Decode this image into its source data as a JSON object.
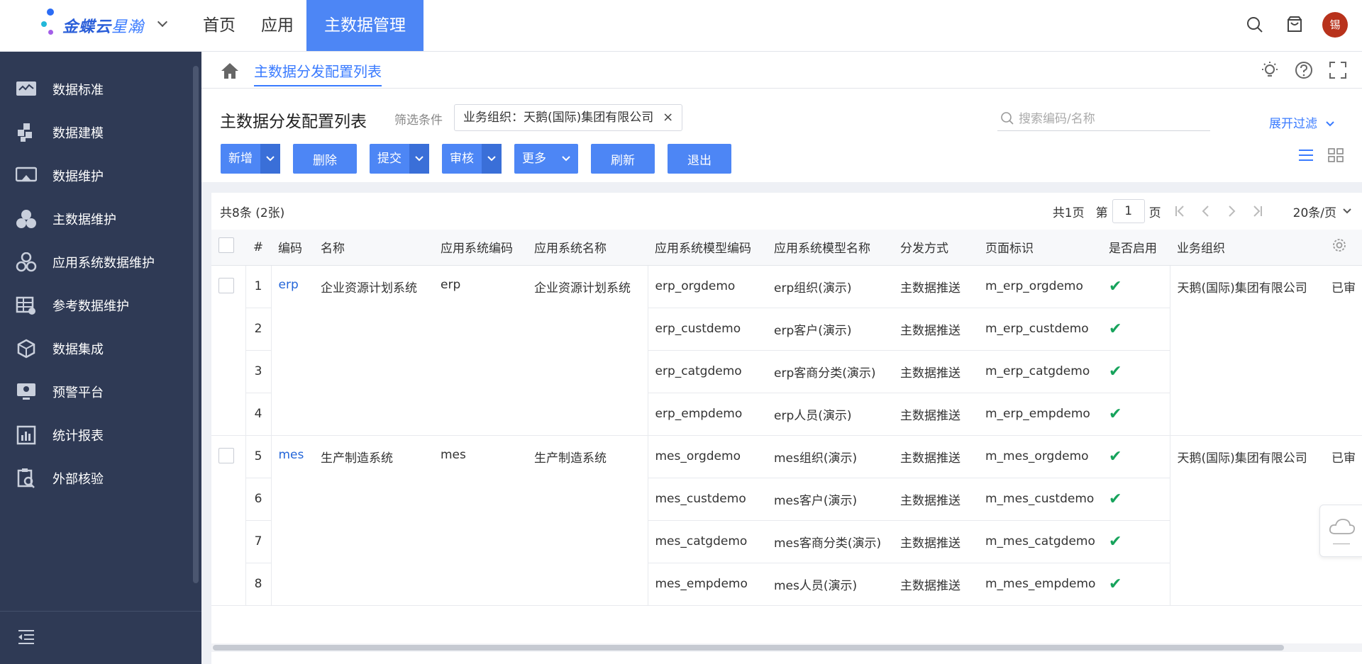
{
  "brand": {
    "name_bold": "金蝶云",
    "name_light": "星瀚"
  },
  "top_nav": [
    {
      "label": "首页",
      "active": false
    },
    {
      "label": "应用",
      "active": false
    },
    {
      "label": "主数据管理",
      "active": true
    }
  ],
  "user": {
    "avatar_text": "锡"
  },
  "sidebar": {
    "items": [
      {
        "label": "数据标准",
        "icon": "monitor-chart-icon"
      },
      {
        "label": "数据建模",
        "icon": "blocks-icon"
      },
      {
        "label": "数据维护",
        "icon": "screen-icon"
      },
      {
        "label": "主数据维护",
        "icon": "circles-icon"
      },
      {
        "label": "应用系统数据维护",
        "icon": "settings-cluster-icon"
      },
      {
        "label": "参考数据维护",
        "icon": "table-gear-icon"
      },
      {
        "label": "数据集成",
        "icon": "cube-icon"
      },
      {
        "label": "预警平台",
        "icon": "alert-screen-icon"
      },
      {
        "label": "统计报表",
        "icon": "bar-report-icon"
      },
      {
        "label": "外部核验",
        "icon": "clipboard-search-icon"
      }
    ]
  },
  "breadcrumb": {
    "current": "主数据分发配置列表"
  },
  "header": {
    "title": "主数据分发配置列表",
    "filter_label": "筛选条件",
    "filter_chip": "业务组织：天鹅(国际)集团有限公司",
    "filter_chip_close": "×",
    "search_placeholder": "搜索编码/名称",
    "expand_filter": "展开过滤"
  },
  "toolbar": {
    "add": "新增",
    "delete": "删除",
    "submit": "提交",
    "audit": "审核",
    "more": "更多",
    "refresh": "刷新",
    "exit": "退出"
  },
  "table": {
    "stats": "共8条 (2张)",
    "pager": {
      "total_pages": "共1页",
      "page_prefix": "第",
      "page_value": "1",
      "page_suffix": "页",
      "page_size": "20条/页"
    },
    "columns": [
      "#",
      "编码",
      "名称",
      "应用系统编码",
      "应用系统名称",
      "应用系统模型编码",
      "应用系统模型名称",
      "分发方式",
      "页面标识",
      "是否启用",
      "业务组织"
    ],
    "groups": [
      {
        "code": "erp",
        "name": "企业资源计划系统",
        "app_code": "erp",
        "app_name": "企业资源计划系统",
        "org": "天鹅(国际)集团有限公司",
        "status_partial": "已审",
        "rows": [
          {
            "seq": "1",
            "model_code": "erp_orgdemo",
            "model_name": "erp组织(演示)",
            "method": "主数据推送",
            "page_id": "m_erp_orgdemo",
            "enabled": "✔"
          },
          {
            "seq": "2",
            "model_code": "erp_custdemo",
            "model_name": "erp客户(演示)",
            "method": "主数据推送",
            "page_id": "m_erp_custdemo",
            "enabled": "✔"
          },
          {
            "seq": "3",
            "model_code": "erp_catgdemo",
            "model_name": "erp客商分类(演示)",
            "method": "主数据推送",
            "page_id": "m_erp_catgdemo",
            "enabled": "✔"
          },
          {
            "seq": "4",
            "model_code": "erp_empdemo",
            "model_name": "erp人员(演示)",
            "method": "主数据推送",
            "page_id": "m_erp_empdemo",
            "enabled": "✔"
          }
        ]
      },
      {
        "code": "mes",
        "name": "生产制造系统",
        "app_code": "mes",
        "app_name": "生产制造系统",
        "org": "天鹅(国际)集团有限公司",
        "status_partial": "已审",
        "rows": [
          {
            "seq": "5",
            "model_code": "mes_orgdemo",
            "model_name": "mes组织(演示)",
            "method": "主数据推送",
            "page_id": "m_mes_orgdemo",
            "enabled": "✔"
          },
          {
            "seq": "6",
            "model_code": "mes_custdemo",
            "model_name": "mes客户(演示)",
            "method": "主数据推送",
            "page_id": "m_mes_custdemo",
            "enabled": "✔"
          },
          {
            "seq": "7",
            "model_code": "mes_catgdemo",
            "model_name": "mes客商分类(演示)",
            "method": "主数据推送",
            "page_id": "m_mes_catgdemo",
            "enabled": "✔"
          },
          {
            "seq": "8",
            "model_code": "mes_empdemo",
            "model_name": "mes人员(演示)",
            "method": "主数据推送",
            "page_id": "m_mes_empdemo",
            "enabled": "✔"
          }
        ]
      }
    ]
  },
  "colors": {
    "primary": "#4d86f5",
    "sidebar_bg": "#2f3a55",
    "link": "#2466d9",
    "check": "#17a35c"
  }
}
